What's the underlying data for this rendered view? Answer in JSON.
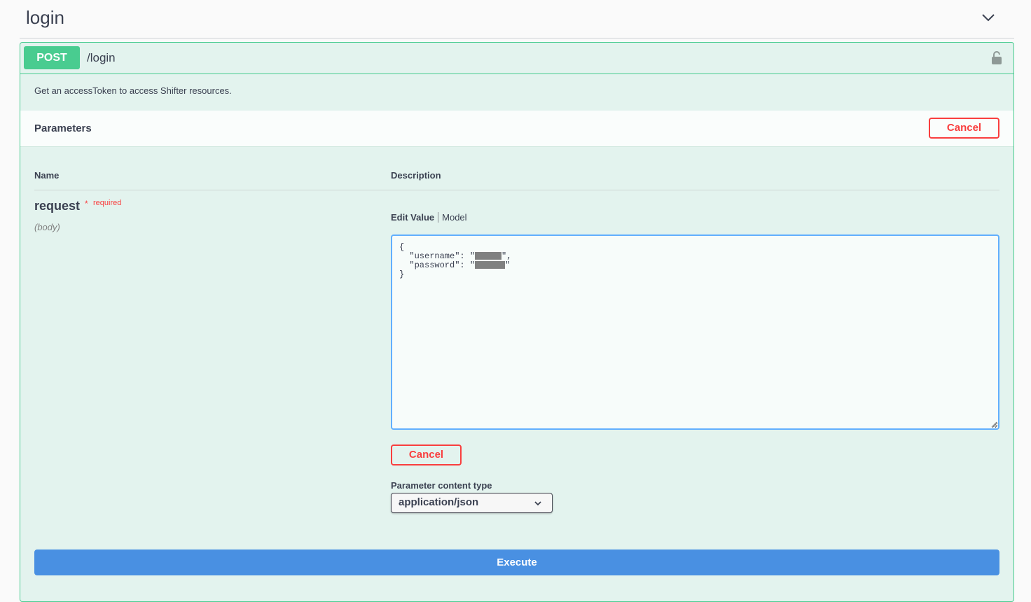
{
  "tag": {
    "title": "login",
    "toggle_icon": "chevron-down-icon"
  },
  "operation": {
    "method": "POST",
    "path": "/login",
    "lock_icon": "lock-icon",
    "description": "Get an accessToken to access Shifter resources.",
    "colors": {
      "method": "#49cc90",
      "background": "#e3f3ee",
      "cancel": "#f93e3e",
      "execute": "#4990e2",
      "editor_border": "#61affe"
    }
  },
  "parameters": {
    "title": "Parameters",
    "cancel_label": "Cancel",
    "columns": {
      "name": "Name",
      "description": "Description"
    },
    "request": {
      "name": "request",
      "required_star": "*",
      "required_label": "required",
      "in": "(body)",
      "tabs": {
        "edit": "Edit Value",
        "model": "Model"
      },
      "body_lines": {
        "open": "{",
        "username_key": "  \"username\": \"",
        "username_tail": "\",",
        "password_key": "  \"password\": \"",
        "password_tail": "\"",
        "close": "}"
      },
      "cancel_label": "Cancel",
      "content_type_label": "Parameter content type",
      "content_type_value": "application/json"
    }
  },
  "execute_label": "Execute"
}
